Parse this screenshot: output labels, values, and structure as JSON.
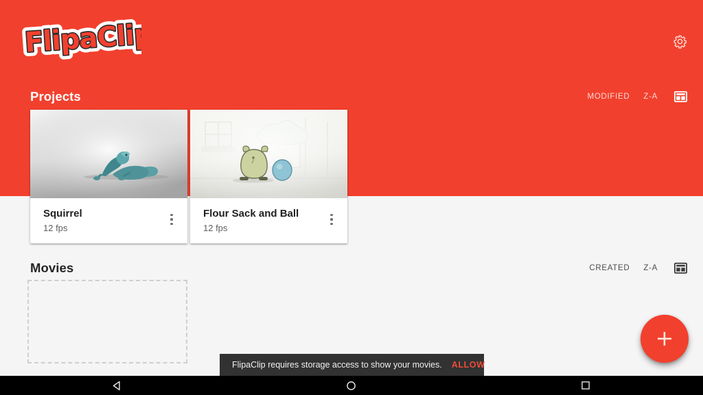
{
  "app": {
    "logo_text": "FlipaClip",
    "brand_color": "#f2402e",
    "settings_icon": "gear-icon"
  },
  "projects_section": {
    "title": "Projects",
    "sort_field_label": "MODIFIED",
    "sort_order_label": "Z-A",
    "view_icon": "grid-view-icon",
    "cards": [
      {
        "title": "Squirrel",
        "subtitle": "12 fps",
        "menu_icon": "more-vertical-icon",
        "thumb_name": "squirrel-thumbnail"
      },
      {
        "title": "Flour Sack and Ball",
        "subtitle": "12 fps",
        "menu_icon": "more-vertical-icon",
        "thumb_name": "flour-sack-thumbnail"
      }
    ]
  },
  "movies_section": {
    "title": "Movies",
    "sort_field_label": "CREATED",
    "sort_order_label": "Z-A",
    "view_icon": "grid-view-icon",
    "placeholder_name": "empty-movies-placeholder"
  },
  "fab": {
    "icon": "plus-icon",
    "color": "#f2402e"
  },
  "snackbar": {
    "message": "FlipaClip requires storage access to show your movies.",
    "action_label": "ALLOW",
    "action_color": "#ef4b3b",
    "background": "#323232"
  },
  "navbar": {
    "back_icon": "back-triangle-icon",
    "home_icon": "home-circle-icon",
    "recents_icon": "recents-square-icon"
  }
}
